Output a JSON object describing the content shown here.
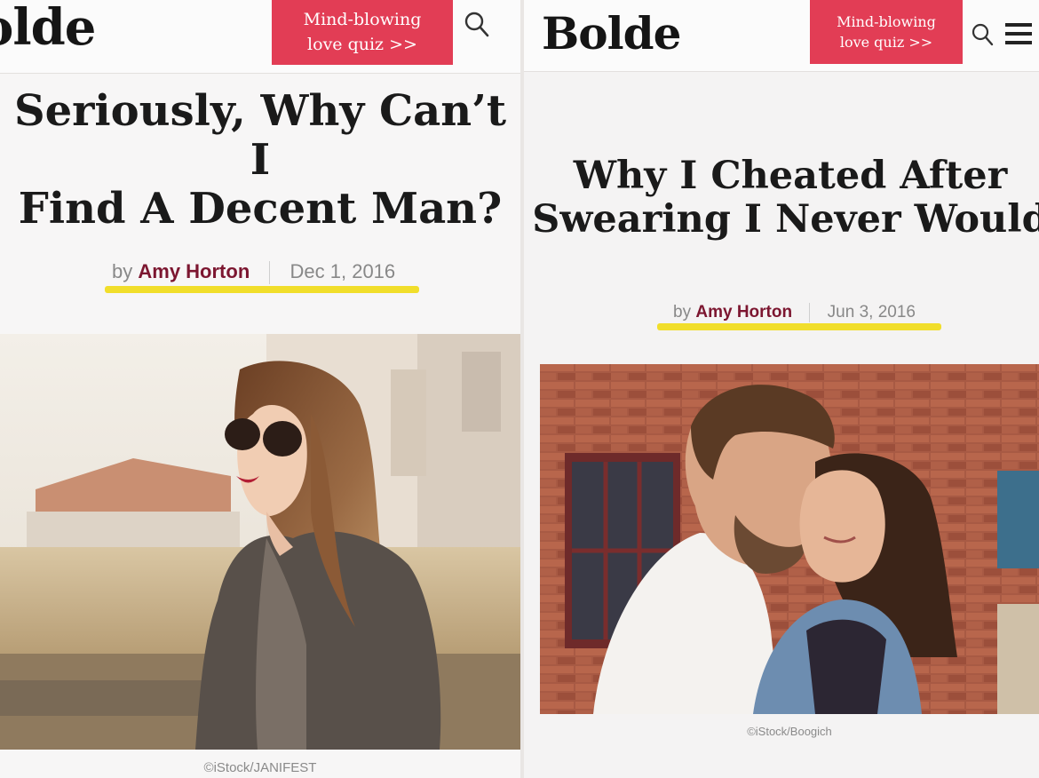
{
  "left": {
    "header": {
      "logo": "olde",
      "quiz_line1": "Mind-blowing",
      "quiz_line2": "love quiz >>"
    },
    "article": {
      "title_line1": "Seriously, Why Can’t I",
      "title_line2": "Find A Decent Man?",
      "by": "by",
      "author": "Amy Horton",
      "date": "Dec 1, 2016",
      "image_credit": "©iStock/JANIFEST"
    },
    "icons": {
      "search": "search-icon"
    }
  },
  "right": {
    "header": {
      "logo": "Bolde",
      "quiz_line1": "Mind-blowing",
      "quiz_line2": "love quiz >>"
    },
    "article": {
      "title_line1": "Why I Cheated After",
      "title_line2": "Swearing I Never Would",
      "by": "by",
      "author": "Amy Horton",
      "date": "Jun 3, 2016",
      "image_credit": "©iStock/Boogich"
    },
    "icons": {
      "search": "search-icon",
      "menu": "hamburger-menu-icon"
    }
  },
  "colors": {
    "quiz_button": "#e23d55",
    "author": "#7c1630",
    "highlight": "#f1de2b"
  }
}
